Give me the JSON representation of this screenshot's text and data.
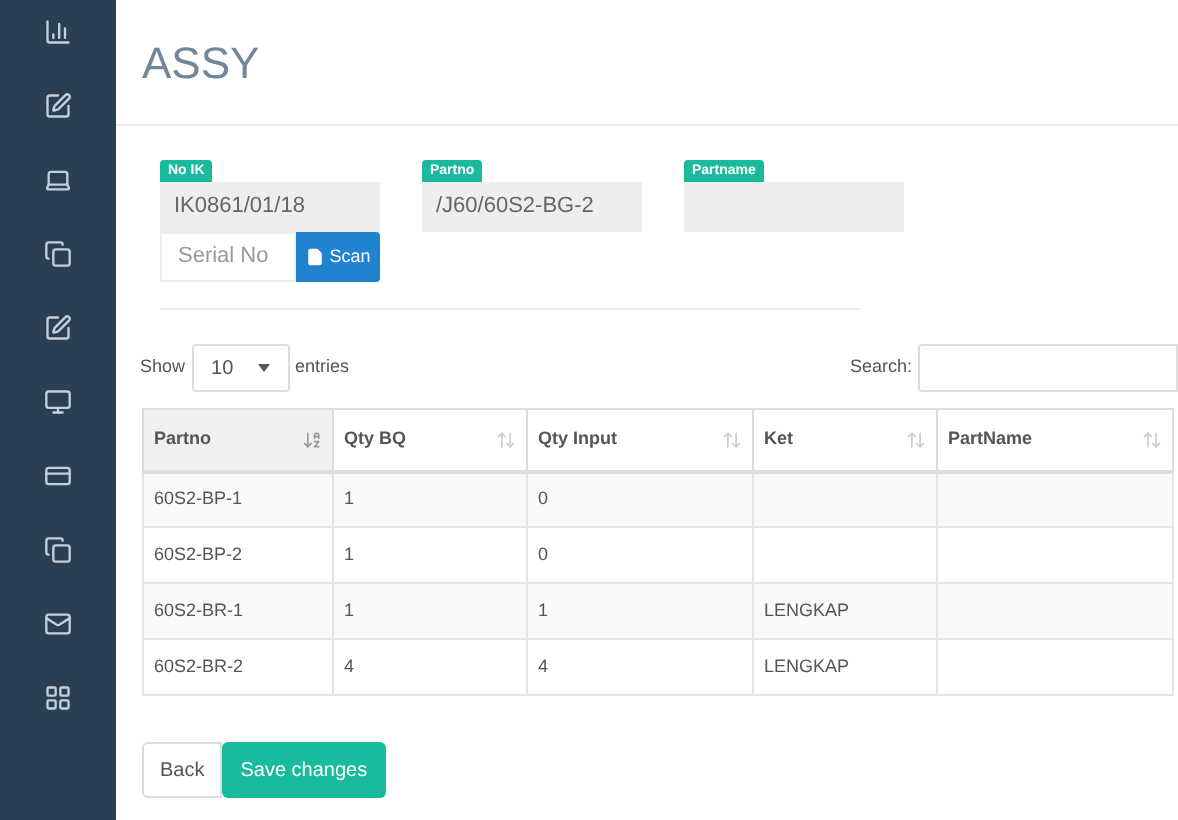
{
  "page_title": "ASSY",
  "form": {
    "fields": [
      {
        "label": "No IK",
        "value": "IK0861/01/18"
      },
      {
        "label": "Partno",
        "value": "/J60/60S2-BG-2"
      },
      {
        "label": "Partname"
      }
    ],
    "serial": {
      "placeholder": "Serial No"
    },
    "scan_button": "Scan"
  },
  "length_menu": {
    "before": "Show",
    "value": "10",
    "after": "entries"
  },
  "search": {
    "label": "Search:"
  },
  "table": {
    "columns": [
      {
        "label": "Partno",
        "sorted": true
      },
      {
        "label": "Qty BQ",
        "sorted": false
      },
      {
        "label": "Qty Input",
        "sorted": false
      },
      {
        "label": "Ket",
        "sorted": false
      },
      {
        "label": "PartName",
        "sorted": false
      }
    ],
    "rows": [
      [
        "60S2-BP-1",
        "1",
        "0",
        "",
        ""
      ],
      [
        "60S2-BP-2",
        "1",
        "0",
        "",
        ""
      ],
      [
        "60S2-BR-1",
        "1",
        "1",
        "LENGKAP",
        ""
      ],
      [
        "60S2-BR-2",
        "4",
        "4",
        "LENGKAP",
        ""
      ]
    ]
  },
  "buttons": {
    "back": "Back",
    "save": "Save changes"
  }
}
